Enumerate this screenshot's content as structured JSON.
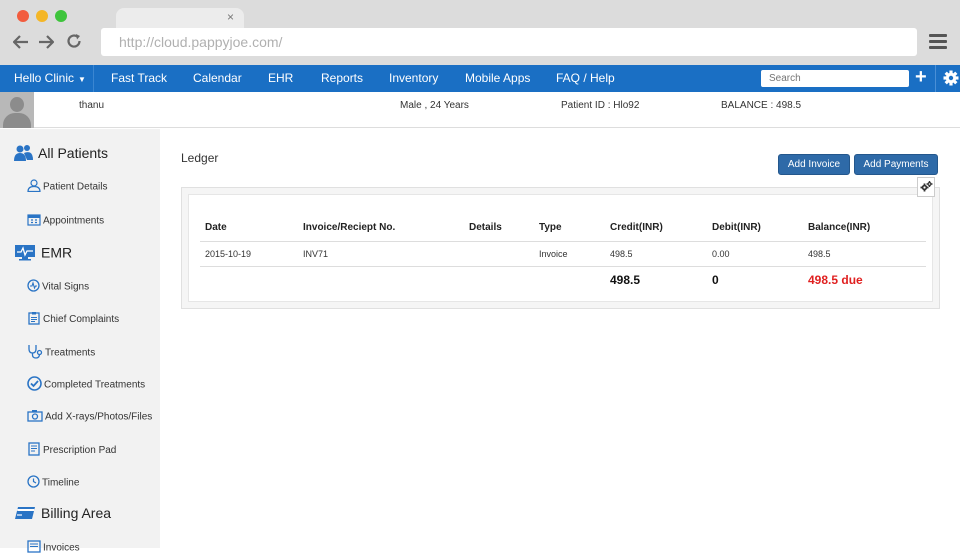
{
  "browser": {
    "url": "http://cloud.pappyjoe.com/",
    "tab_close": "×"
  },
  "nav": {
    "clinic": "Hello Clinic",
    "items": [
      "Fast Track",
      "Calendar",
      "EHR",
      "Reports",
      "Inventory",
      "Mobile Apps",
      "FAQ / Help"
    ],
    "search_placeholder": "Search"
  },
  "patient": {
    "name": "thanu",
    "gender_age": "Male , 24 Years",
    "id": "Patient ID : Hlo92",
    "balance": "BALANCE :  498.5"
  },
  "sidebar": {
    "all_patients": "All Patients",
    "patient_details": "Patient Details",
    "appointments": "Appointments",
    "emr": "EMR",
    "vital_signs": "Vital Signs",
    "chief_complaints": "Chief Complaints",
    "treatments": "Treatments",
    "completed_treatments": "Completed Treatments",
    "xrays": "Add X-rays/Photos/Files",
    "prescription": "Prescription Pad",
    "timeline": "Timeline",
    "billing": "Billing Area",
    "invoices": "Invoices"
  },
  "main": {
    "title": "Ledger",
    "add_invoice": "Add Invoice",
    "add_payments": "Add Payments"
  },
  "ledger": {
    "headers": [
      "Date",
      "Invoice/Reciept No.",
      "Details",
      "Type",
      "Credit(INR)",
      "Debit(INR)",
      "Balance(INR)"
    ],
    "rows": [
      [
        "2015-10-19",
        "INV71",
        "",
        "Invoice",
        "498.5",
        "0.00",
        "498.5"
      ]
    ],
    "total_credit": "498.5",
    "total_debit": "0",
    "total_balance": "498.5 due"
  },
  "colors": {
    "nav_blue": "#1a6fc4",
    "button_blue": "#2e6aa8",
    "due_red": "#e02020"
  }
}
